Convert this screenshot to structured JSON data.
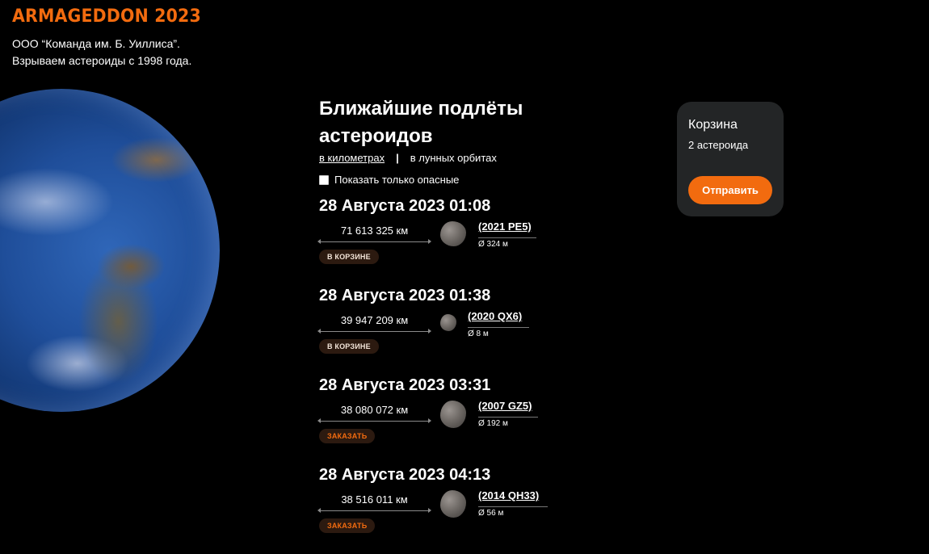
{
  "header": {
    "logo": "ARMAGEDDON 2023",
    "tagline_1": "ООО “Команда им. Б. Уиллиса”.",
    "tagline_2": "Взрываем астероиды с 1998 года."
  },
  "main": {
    "title_1": "Ближайшие подлёты",
    "title_2": "астероидов",
    "units": {
      "km": "в километрах",
      "separator": "|",
      "lunar": "в лунных орбитах",
      "active": "km"
    },
    "filter_label": "Показать только опасные",
    "filter_checked": false
  },
  "asteroids": [
    {
      "date": "28 Августа 2023 01:08",
      "distance": "71 613 325 км",
      "name": "(2021 PE5)",
      "diameter": "Ø 324 м",
      "action": "В КОРЗИНЕ"
    },
    {
      "date": "28 Августа 2023 01:38",
      "distance": "39 947 209 км",
      "name": "(2020 QX6)",
      "diameter": "Ø 8 м",
      "action": "В КОРЗИНЕ"
    },
    {
      "date": "28 Августа 2023 03:31",
      "distance": "38 080 072 км",
      "name": "(2007 GZ5)",
      "diameter": "Ø 192 м",
      "action": "ЗАКАЗАТЬ"
    },
    {
      "date": "28 Августа 2023 04:13",
      "distance": "38 516 011 км",
      "name": "(2014 QH33)",
      "diameter": "Ø 56 м",
      "action": "ЗАКАЗАТЬ"
    }
  ],
  "cart": {
    "title": "Корзина",
    "count": "2 астероида",
    "send_label": "Отправить"
  },
  "colors": {
    "accent": "#f26b0f",
    "background": "#000000",
    "card": "#232526"
  }
}
